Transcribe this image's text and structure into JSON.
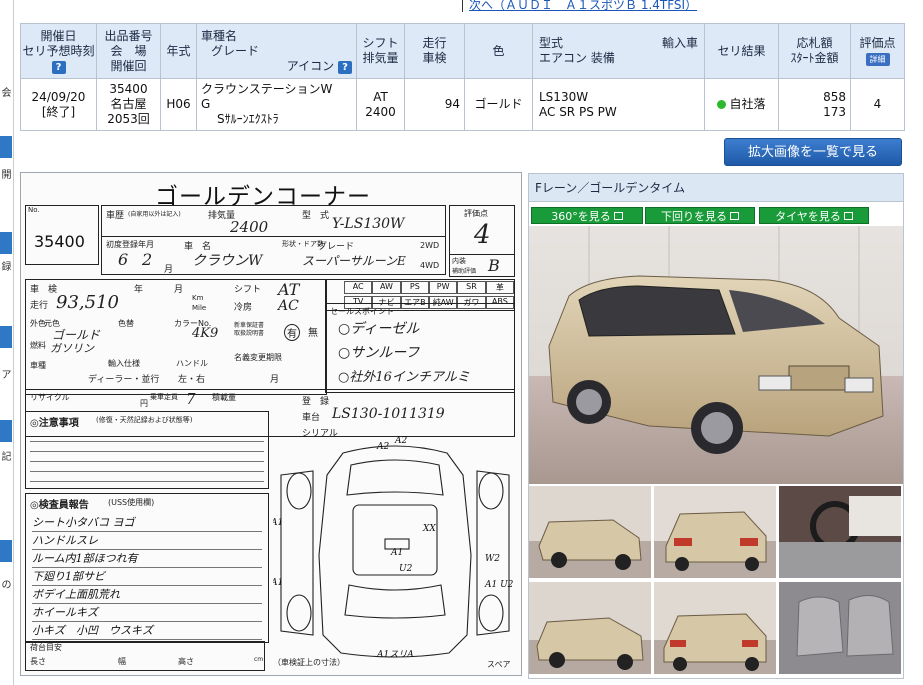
{
  "nav": {
    "next_label": "次へ（ＡＵＤＩ　Ａ１スポツＢ 1.4TFSI）"
  },
  "left_strip": {
    "items": [
      "会",
      "開",
      "o",
      "録",
      "ア",
      "記",
      "の"
    ]
  },
  "table": {
    "headers": {
      "h_date_1": "開催日",
      "h_date_2": "セリ予想時刻",
      "h_lot_1": "出品番号",
      "h_lot_2": "会　場",
      "h_lot_3": "開催回",
      "h_year": "年式",
      "h_model_1": "車種名",
      "h_model_2": "グレード",
      "h_model_3": "アイコン",
      "h_shift_1": "シフト",
      "h_shift_2": "排気量",
      "h_mileage_1": "走行",
      "h_mileage_2": "車検",
      "h_color": "色",
      "h_type_1": "型式",
      "h_type_2": "輸入車",
      "h_type_3": "エアコン 装備",
      "h_result": "セリ結果",
      "h_bid_1": "応札額",
      "h_bid_2": "ｽﾀｰﾄ金額",
      "h_score_1": "評価点",
      "h_score_badge": "詳細"
    },
    "row": {
      "date": "24/09/20",
      "status": "[終了]",
      "lot": "35400",
      "venue": "名古屋",
      "session": "2053回",
      "year": "H06",
      "model": "クラウンステーションW",
      "model_cont": "G",
      "grade": "Sｻﾙｰﾝｴｸｽﾄﾗ",
      "shift": "AT",
      "displacement": "2400",
      "mileage": "94",
      "color": "ゴールド",
      "type_code": "LS130W",
      "equipment": "AC SR PS PW",
      "result": "自社落",
      "bid": "858",
      "start_price": "173",
      "score": "4"
    }
  },
  "expand_button": "拡大画像を一覧で見る",
  "sheet": {
    "title": "ゴールデンコーナー",
    "lot_label": "No.",
    "lot_no": "35400",
    "labels": {
      "history": "車歴",
      "history_note": "(自家用以外は記入)",
      "displacement": "排気量",
      "type": "型　式",
      "score": "評価点",
      "first_reg": "初度登録年月",
      "car_name": "車　名",
      "shape": "形状・ドア数",
      "grade": "グレード",
      "twowd": "2WD",
      "fourwd": "4WD",
      "interior": "内装",
      "interior_sub": "補助評価",
      "inspection": "車　検",
      "shift": "シフト",
      "mileage": "走行",
      "km": "Km",
      "mile": "Mile",
      "ext_color": "外色",
      "orig_color": "元色",
      "color_no": "色替",
      "color_no2": "カラーNo.",
      "fuel": "燃料",
      "aircon": "冷房",
      "new_car_warranty": "新車保証書",
      "manual": "取扱説明書",
      "yes": "有",
      "no": "無",
      "passenger": "車種",
      "import": "輸入仕様",
      "handle": "ハンドル",
      "name_change": "名義変更期限",
      "recycle": "リサイクル",
      "capacity": "乗車定員",
      "load": "積載量",
      "reg_no": "登　録",
      "chassis": "車台",
      "serial": "シリアル",
      "notes_title": "◎注意事項",
      "notes_sub": "(修復・天然記録および状態等)",
      "inspector_title": "◎検査員報告",
      "inspector_sub": "(USS使用欄)",
      "sale_points": "セールスポイント",
      "cargo": "荷台目安",
      "length": "長さ",
      "width": "幅",
      "height": "高さ",
      "cm": "cm",
      "vehicle_size": "（車検証上の寸法）",
      "spare": "スペア",
      "month": "月",
      "year": "年",
      "yen": "円"
    },
    "equip_grid": [
      "AC",
      "AW",
      "PS",
      "PW",
      "SR",
      "革",
      "TV",
      "ナビ",
      "エアB",
      "純AW",
      "ガワ",
      "ABS"
    ],
    "hand": {
      "displacement": "2400",
      "type": "Y-LS130W",
      "score": "4",
      "first_reg_year": "6",
      "first_reg_month": "2",
      "car_name": "クラウンW",
      "grade": "スーパーサルーンE",
      "interior": "B",
      "shift": "AT",
      "mileage": "93,510",
      "aircon": "AC",
      "color": "ゴールド",
      "color_no": "4K9",
      "fuel": "ガソリン",
      "dealer": "ディーラー・並行",
      "handle": "左・右",
      "capacity": "7",
      "chassis": "LS130-1011319",
      "sale1": "○ディーゼル",
      "sale2": "○サンルーフ",
      "sale3": "○社外16インチアルミ",
      "report": [
        "シート小タバコ ヨゴ",
        "ハンドルスレ",
        "ルーム内1部ほつれ有",
        "下廻り1部サビ",
        "ボデイ上面肌荒れ",
        "ホイールキズ",
        "小キズ　小凹　ウスキズ"
      ],
      "marks": [
        "A2",
        "A1",
        "A1",
        "W2",
        "A1 U2",
        "XX",
        "A1",
        "U2",
        "A1スリA",
        "A2"
      ]
    }
  },
  "photos": {
    "header": "Fレーン／ゴールデンタイム",
    "btn_360": "360°を見る",
    "btn_under": "下回りを見る",
    "btn_tire": "タイヤを見る"
  }
}
